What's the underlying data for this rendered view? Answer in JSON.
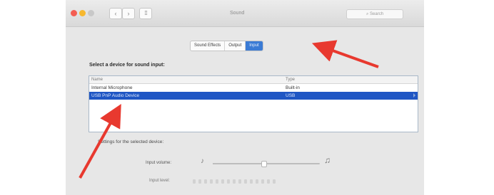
{
  "window": {
    "title": "Sound",
    "search_placeholder": "Search",
    "back_glyph": "‹",
    "forward_glyph": "›",
    "grid_glyph": "⁞⁞⁞",
    "traffic_lights": [
      "close",
      "minimize",
      "zoom"
    ]
  },
  "tabs": [
    {
      "label": "Sound Effects",
      "active": false
    },
    {
      "label": "Output",
      "active": false
    },
    {
      "label": "Input",
      "active": true
    }
  ],
  "input": {
    "section_label": "Select a device for sound input:",
    "columns": {
      "name": "Name",
      "type": "Type"
    },
    "devices": [
      {
        "name": "Internal Microphone",
        "type": "Built-in",
        "selected": false
      },
      {
        "name": "USB PnP Audio Device",
        "type": "USB",
        "selected": true
      }
    ],
    "settings_label": "Settings for the selected device:",
    "volume_label": "Input volume:",
    "volume_level": 0.47,
    "level_label": "Input level:",
    "level_segments": 15,
    "level_active": 0
  },
  "colors": {
    "accent": "#1f56c4",
    "tab_active": "#3a7bd5",
    "annotation_arrow": "#e8392f"
  },
  "icons": {
    "mic_low": "microphone-low-icon",
    "mic_high": "microphone-high-icon"
  }
}
